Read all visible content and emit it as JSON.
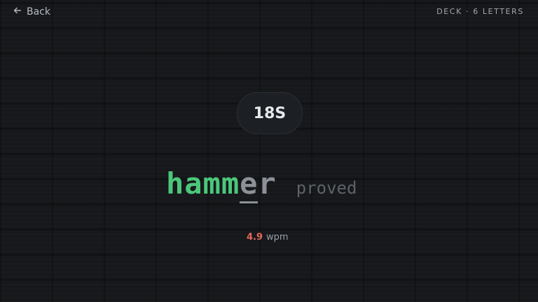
{
  "header": {
    "back_label": "Back",
    "deck_info": "DECK · 6 LETTERS"
  },
  "timer": {
    "value": "18S"
  },
  "word": {
    "typed": "hamm",
    "cursor_char": "e",
    "remaining": "r",
    "next_word": "proved"
  },
  "stats": {
    "wpm_value": "4.9",
    "wpm_unit": "wpm"
  },
  "colors": {
    "background": "#16181b",
    "typed": "#4cc77a",
    "untyped": "#8c9198",
    "next": "#5d6268",
    "wpm_value": "#e5675b"
  },
  "icons": {
    "back": "arrow-left-icon"
  }
}
